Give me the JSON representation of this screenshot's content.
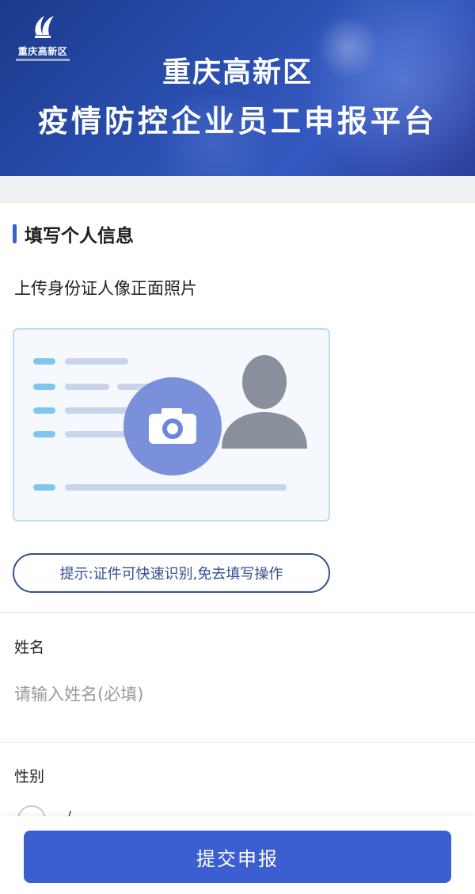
{
  "header": {
    "logo_text": "重庆高新区",
    "title_line1": "重庆高新区",
    "title_line2": "疫情防控企业员工申报平台"
  },
  "section": {
    "title": "填写个人信息"
  },
  "upload": {
    "label": "上传身份证人像正面照片",
    "icon": "camera-icon",
    "tip": "提示:证件可快速识别,免去填写操作"
  },
  "form": {
    "name": {
      "label": "姓名",
      "placeholder": "请输入姓名(必填)",
      "value": ""
    },
    "gender": {
      "label": "性别",
      "option_partial": "/"
    }
  },
  "submit": {
    "label": "提交申报"
  },
  "colors": {
    "banner": "#2a4fb0",
    "accent": "#3b5fd0",
    "tip_border": "#35508f",
    "card_border": "#b9def0"
  }
}
